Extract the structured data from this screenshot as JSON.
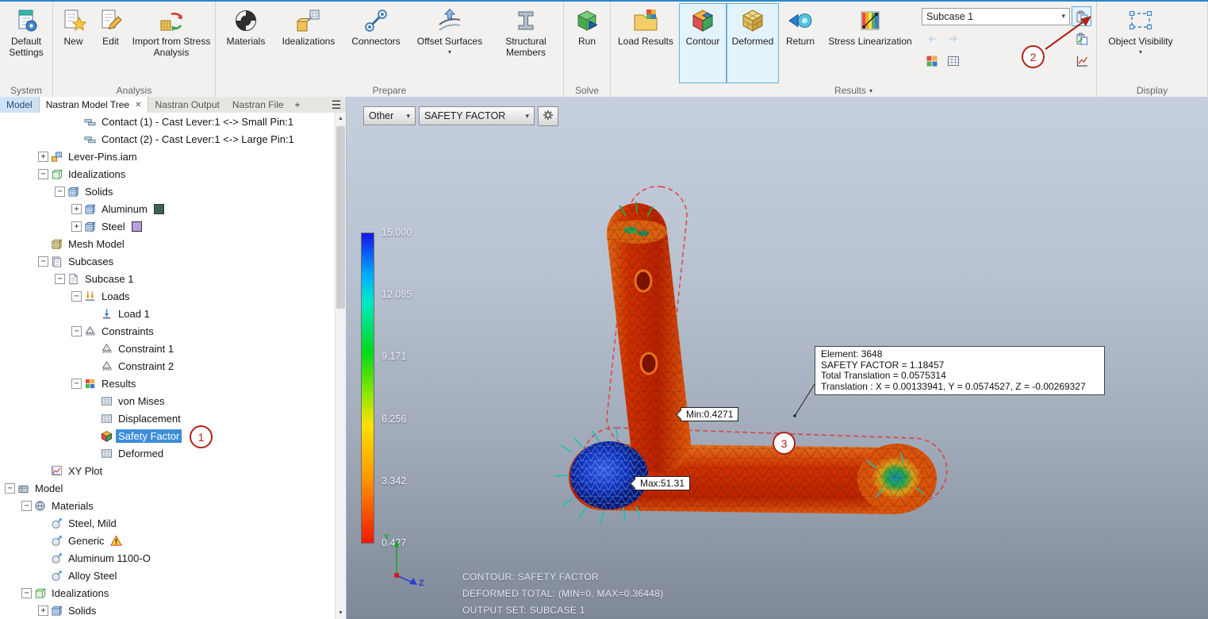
{
  "colors": {
    "selection_blue": "#3d8edb",
    "callout_red": "#b02418",
    "active_tool_border": "#66b2e0",
    "legend_top": "#1414e8",
    "legend_bottom": "#f01800"
  },
  "ribbon": {
    "groups": [
      {
        "label": "System",
        "items": [
          {
            "label": "Default Settings",
            "icon": "default-settings"
          }
        ]
      },
      {
        "label": "Analysis",
        "items": [
          {
            "label": "New",
            "icon": "new"
          },
          {
            "label": "Edit",
            "icon": "edit"
          },
          {
            "label": "Import from Stress Analysis",
            "icon": "import-stress"
          }
        ]
      },
      {
        "label": "Prepare",
        "items": [
          {
            "label": "Materials",
            "icon": "materials"
          },
          {
            "label": "Idealizations",
            "icon": "idealizations"
          },
          {
            "label": "Connectors",
            "icon": "connectors"
          },
          {
            "label": "Offset Surfaces",
            "icon": "offset-surfaces",
            "dropdown": true
          },
          {
            "label": "Structural Members",
            "icon": "structural-members"
          }
        ]
      },
      {
        "label": "Solve",
        "items": [
          {
            "label": "Run",
            "icon": "run"
          }
        ]
      },
      {
        "label": "Results",
        "has_dropdown": true,
        "items": [
          {
            "label": "Load Results",
            "icon": "load-results"
          },
          {
            "label": "Contour",
            "icon": "contour",
            "active": true
          },
          {
            "label": "Deformed",
            "icon": "deformed",
            "active": true
          },
          {
            "label": "Return",
            "icon": "return"
          },
          {
            "label": "Stress Linearization",
            "icon": "stress-linearization"
          }
        ]
      },
      {
        "label": "Display",
        "items": [
          {
            "label": "Object Visibility",
            "icon": "object-visibility",
            "dropdown": true
          }
        ]
      }
    ],
    "subcase": {
      "value": "Subcase 1"
    }
  },
  "panel_tabs": [
    {
      "label": "Model",
      "style": "model"
    },
    {
      "label": "Nastran Model Tree",
      "active": true,
      "closable": true
    },
    {
      "label": "Nastran Output"
    },
    {
      "label": "Nastran File"
    },
    {
      "label": "+",
      "style": "add"
    }
  ],
  "tree": [
    {
      "label": "Contact (1) - Cast Lever:1 <-> Small Pin:1",
      "level": 4,
      "icon": "contact"
    },
    {
      "label": "Contact (2) - Cast Lever:1 <-> Large Pin:1",
      "level": 4,
      "icon": "contact"
    },
    {
      "label": "Lever-Pins.iam",
      "level": 2,
      "expand": "+",
      "icon": "assembly"
    },
    {
      "label": "Idealizations",
      "level": 2,
      "expand": "-",
      "icon": "idealizations"
    },
    {
      "label": "Solids",
      "level": 3,
      "expand": "-",
      "icon": "solids"
    },
    {
      "label": "Aluminum",
      "level": 4,
      "expand": "+",
      "icon": "solids",
      "swatch": "#3d6152"
    },
    {
      "label": "Steel",
      "level": 4,
      "expand": "+",
      "icon": "solids",
      "swatch": "#b9a0e3"
    },
    {
      "label": "Mesh Model",
      "level": 2,
      "icon": "mesh-model"
    },
    {
      "label": "Subcases",
      "level": 2,
      "expand": "-",
      "icon": "subcases"
    },
    {
      "label": "Subcase 1",
      "level": 3,
      "expand": "-",
      "icon": "subcase"
    },
    {
      "label": "Loads",
      "level": 4,
      "expand": "-",
      "icon": "loads"
    },
    {
      "label": "Load 1",
      "level": 5,
      "icon": "load"
    },
    {
      "label": "Constraints",
      "level": 4,
      "expand": "-",
      "icon": "constraints"
    },
    {
      "label": "Constraint 1",
      "level": 5,
      "icon": "constraint"
    },
    {
      "label": "Constraint 2",
      "level": 5,
      "icon": "constraint"
    },
    {
      "label": "Results",
      "level": 4,
      "expand": "-",
      "icon": "results"
    },
    {
      "label": "von Mises",
      "level": 5,
      "icon": "plot"
    },
    {
      "label": "Displacement",
      "level": 5,
      "icon": "plot"
    },
    {
      "label": "Safety Factor",
      "level": 5,
      "icon": "safety",
      "selected": true
    },
    {
      "label": "Deformed",
      "level": 5,
      "icon": "plot"
    },
    {
      "label": "XY Plot",
      "level": 2,
      "icon": "xy-plot"
    },
    {
      "label": "Model",
      "level": 0,
      "expand": "-",
      "icon": "model"
    },
    {
      "label": "Materials",
      "level": 1,
      "expand": "-",
      "icon": "materials-folder"
    },
    {
      "label": "Steel, Mild",
      "level": 2,
      "icon": "material"
    },
    {
      "label": "Generic",
      "level": 2,
      "icon": "material",
      "warning": true
    },
    {
      "label": "Aluminum 1100-O",
      "level": 2,
      "icon": "material"
    },
    {
      "label": "Alloy Steel",
      "level": 2,
      "icon": "material"
    },
    {
      "label": "Idealizations",
      "level": 1,
      "expand": "-",
      "icon": "idealizations"
    },
    {
      "label": "Solids",
      "level": 2,
      "expand": "+",
      "icon": "solids"
    }
  ],
  "viewport": {
    "toolbar": {
      "category": "Other",
      "result": "SAFETY FACTOR"
    },
    "legend": {
      "labels": [
        "15.000",
        "12.085",
        "9.171",
        "6.256",
        "3.342",
        "0.427"
      ]
    },
    "flags": {
      "min": "Min:0.4271",
      "max": "Max:51.31"
    },
    "probe": {
      "lines": [
        "Element: 3648",
        "SAFETY FACTOR = 1.18457",
        "Total Translation = 0.0575314",
        "Translation : X = 0.00133941, Y = 0.0574527, Z = -0.00269327"
      ]
    },
    "footer": [
      "CONTOUR: SAFETY FACTOR",
      "DEFORMED TOTAL: (MIN=0, MAX=0.36448)",
      "OUTPUT SET: SUBCASE 1"
    ],
    "triad": {
      "y": "Y",
      "z": "Z"
    }
  },
  "callouts": {
    "step1": "1",
    "step2": "2",
    "step3": "3"
  }
}
